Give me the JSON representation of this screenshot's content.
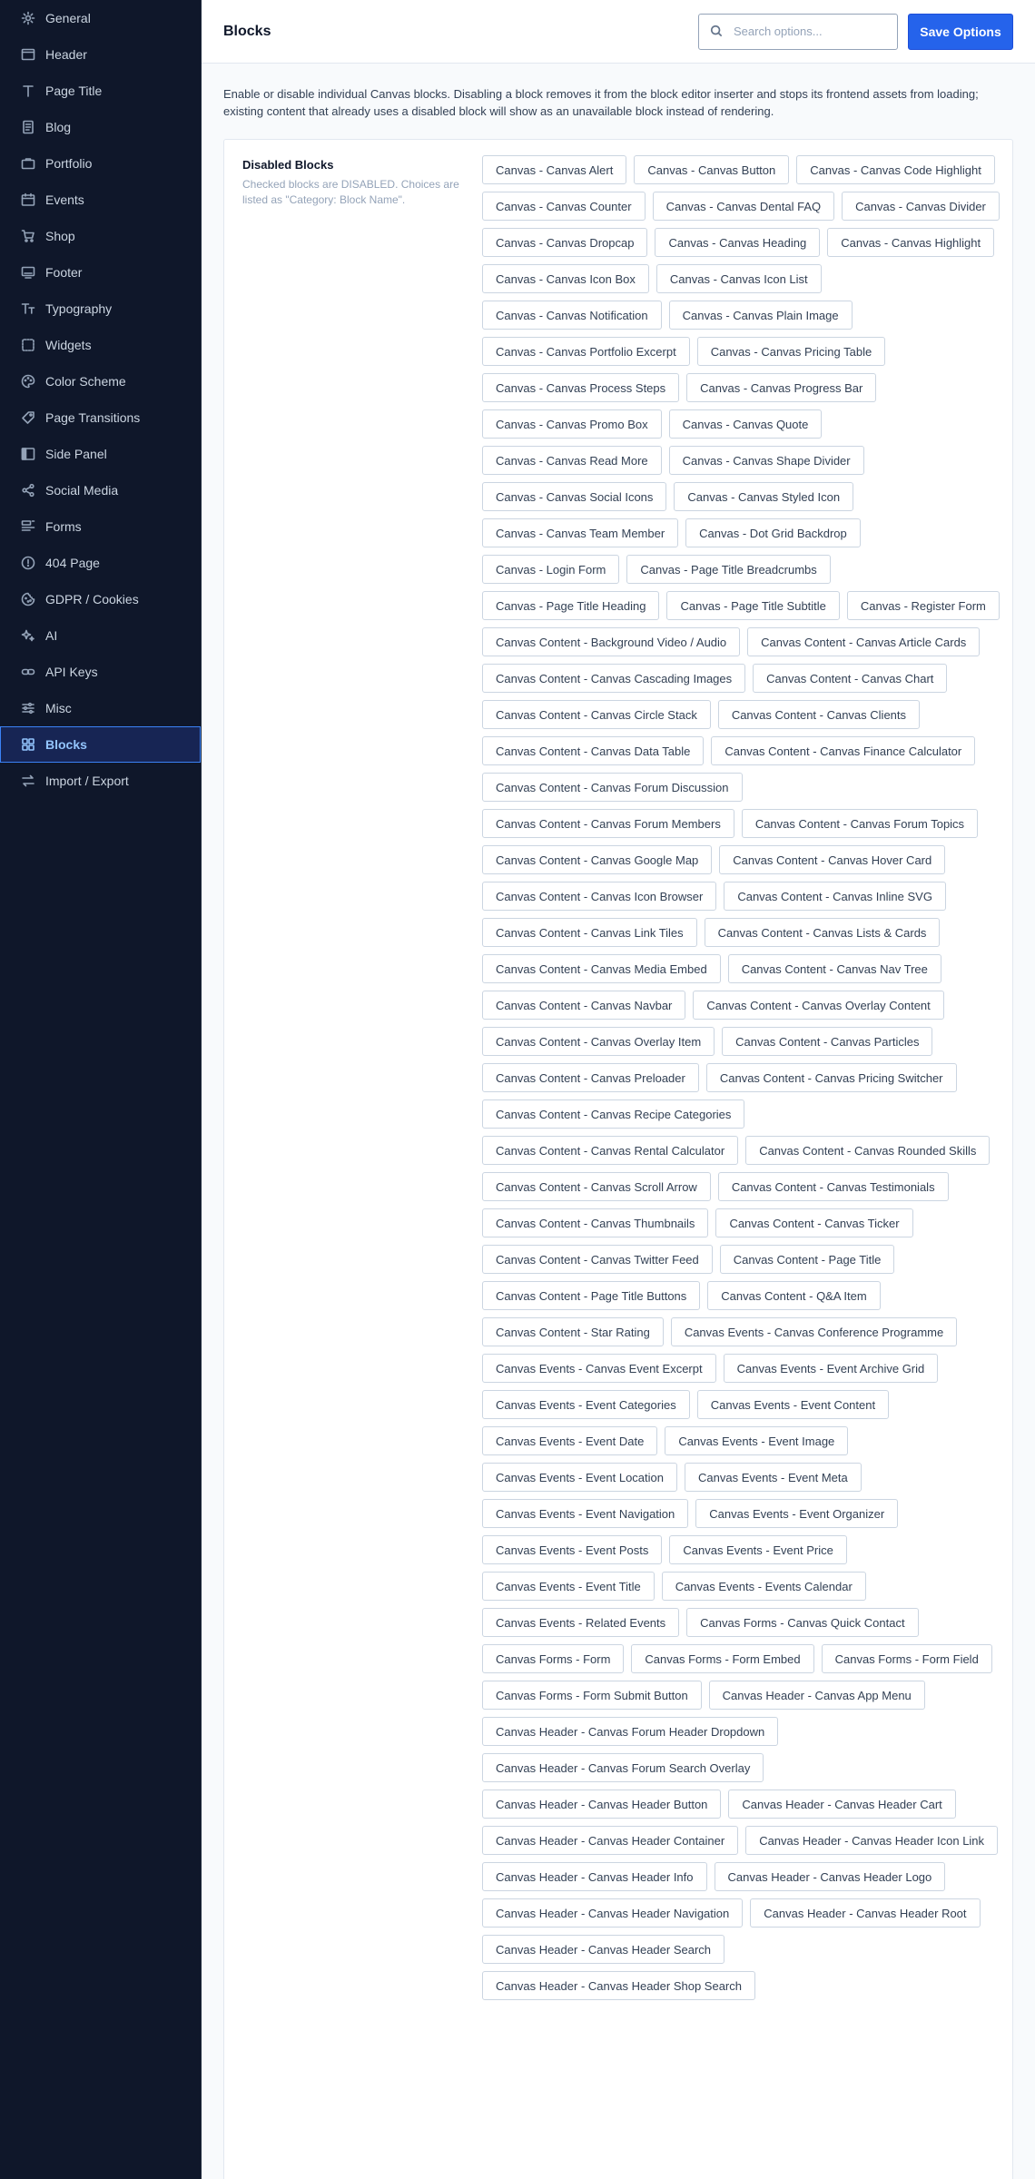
{
  "sidebar": {
    "items": [
      {
        "label": "General",
        "icon": "gear-icon"
      },
      {
        "label": "Header",
        "icon": "window-icon"
      },
      {
        "label": "Page Title",
        "icon": "text-t-icon"
      },
      {
        "label": "Blog",
        "icon": "document-icon"
      },
      {
        "label": "Portfolio",
        "icon": "briefcase-icon"
      },
      {
        "label": "Events",
        "icon": "calendar-icon"
      },
      {
        "label": "Shop",
        "icon": "cart-icon"
      },
      {
        "label": "Footer",
        "icon": "monitor-icon"
      },
      {
        "label": "Typography",
        "icon": "typography-icon"
      },
      {
        "label": "Widgets",
        "icon": "widget-square-icon"
      },
      {
        "label": "Color Scheme",
        "icon": "palette-icon"
      },
      {
        "label": "Page Transitions",
        "icon": "tag-icon"
      },
      {
        "label": "Side Panel",
        "icon": "side-panel-icon"
      },
      {
        "label": "Social Media",
        "icon": "share-icon"
      },
      {
        "label": "Forms",
        "icon": "form-icon"
      },
      {
        "label": "404 Page",
        "icon": "alert-circle-icon"
      },
      {
        "label": "GDPR / Cookies",
        "icon": "cookie-icon"
      },
      {
        "label": "AI",
        "icon": "sparkles-icon"
      },
      {
        "label": "API Keys",
        "icon": "link-icon"
      },
      {
        "label": "Misc",
        "icon": "sliders-icon"
      },
      {
        "label": "Blocks",
        "icon": "grid-icon",
        "active": true
      },
      {
        "label": "Import / Export",
        "icon": "arrows-swap-icon"
      }
    ]
  },
  "header": {
    "title": "Blocks",
    "search_placeholder": "Search options...",
    "save_label": "Save Options"
  },
  "intro": "Enable or disable individual Canvas blocks. Disabling a block removes it from the block editor inserter and stops its frontend assets from loading; existing content that already uses a disabled block will show as an unavailable block instead of rendering.",
  "disabled_blocks": {
    "heading": "Disabled Blocks",
    "help": "Checked blocks are DISABLED. Choices are listed as \"Category: Block Name\".",
    "items": [
      "Canvas - Canvas Alert",
      "Canvas - Canvas Button",
      "Canvas - Canvas Code Highlight",
      "Canvas - Canvas Counter",
      "Canvas - Canvas Dental FAQ",
      "Canvas - Canvas Divider",
      "Canvas - Canvas Dropcap",
      "Canvas - Canvas Heading",
      "Canvas - Canvas Highlight",
      "Canvas - Canvas Icon Box",
      "Canvas - Canvas Icon List",
      "Canvas - Canvas Notification",
      "Canvas - Canvas Plain Image",
      "Canvas - Canvas Portfolio Excerpt",
      "Canvas - Canvas Pricing Table",
      "Canvas - Canvas Process Steps",
      "Canvas - Canvas Progress Bar",
      "Canvas - Canvas Promo Box",
      "Canvas - Canvas Quote",
      "Canvas - Canvas Read More",
      "Canvas - Canvas Shape Divider",
      "Canvas - Canvas Social Icons",
      "Canvas - Canvas Styled Icon",
      "Canvas - Canvas Team Member",
      "Canvas - Dot Grid Backdrop",
      "Canvas - Login Form",
      "Canvas - Page Title Breadcrumbs",
      "Canvas - Page Title Heading",
      "Canvas - Page Title Subtitle",
      "Canvas - Register Form",
      "Canvas Content - Background Video / Audio",
      "Canvas Content - Canvas Article Cards",
      "Canvas Content - Canvas Cascading Images",
      "Canvas Content - Canvas Chart",
      "Canvas Content - Canvas Circle Stack",
      "Canvas Content - Canvas Clients",
      "Canvas Content - Canvas Data Table",
      "Canvas Content - Canvas Finance Calculator",
      "Canvas Content - Canvas Forum Discussion",
      "Canvas Content - Canvas Forum Members",
      "Canvas Content - Canvas Forum Topics",
      "Canvas Content - Canvas Google Map",
      "Canvas Content - Canvas Hover Card",
      "Canvas Content - Canvas Icon Browser",
      "Canvas Content - Canvas Inline SVG",
      "Canvas Content - Canvas Link Tiles",
      "Canvas Content - Canvas Lists & Cards",
      "Canvas Content - Canvas Media Embed",
      "Canvas Content - Canvas Nav Tree",
      "Canvas Content - Canvas Navbar",
      "Canvas Content - Canvas Overlay Content",
      "Canvas Content - Canvas Overlay Item",
      "Canvas Content - Canvas Particles",
      "Canvas Content - Canvas Preloader",
      "Canvas Content - Canvas Pricing Switcher",
      "Canvas Content - Canvas Recipe Categories",
      "Canvas Content - Canvas Rental Calculator",
      "Canvas Content - Canvas Rounded Skills",
      "Canvas Content - Canvas Scroll Arrow",
      "Canvas Content - Canvas Testimonials",
      "Canvas Content - Canvas Thumbnails",
      "Canvas Content - Canvas Ticker",
      "Canvas Content - Canvas Twitter Feed",
      "Canvas Content - Page Title",
      "Canvas Content - Page Title Buttons",
      "Canvas Content - Q&A Item",
      "Canvas Content - Star Rating",
      "Canvas Events - Canvas Conference Programme",
      "Canvas Events - Canvas Event Excerpt",
      "Canvas Events - Event Archive Grid",
      "Canvas Events - Event Categories",
      "Canvas Events - Event Content",
      "Canvas Events - Event Date",
      "Canvas Events - Event Image",
      "Canvas Events - Event Location",
      "Canvas Events - Event Meta",
      "Canvas Events - Event Navigation",
      "Canvas Events - Event Organizer",
      "Canvas Events - Event Posts",
      "Canvas Events - Event Price",
      "Canvas Events - Event Title",
      "Canvas Events - Events Calendar",
      "Canvas Events - Related Events",
      "Canvas Forms - Canvas Quick Contact",
      "Canvas Forms - Form",
      "Canvas Forms - Form Embed",
      "Canvas Forms - Form Field",
      "Canvas Forms - Form Submit Button",
      "Canvas Header - Canvas App Menu",
      "Canvas Header - Canvas Forum Header Dropdown",
      "Canvas Header - Canvas Forum Search Overlay",
      "Canvas Header - Canvas Header Button",
      "Canvas Header - Canvas Header Cart",
      "Canvas Header - Canvas Header Container",
      "Canvas Header - Canvas Header Icon Link",
      "Canvas Header - Canvas Header Info",
      "Canvas Header - Canvas Header Logo",
      "Canvas Header - Canvas Header Navigation",
      "Canvas Header - Canvas Header Root",
      "Canvas Header - Canvas Header Search",
      "Canvas Header - Canvas Header Shop Search"
    ]
  },
  "colors": {
    "sidebar_bg": "#0f172a",
    "accent": "#2563eb",
    "active_bg": "#172554"
  }
}
